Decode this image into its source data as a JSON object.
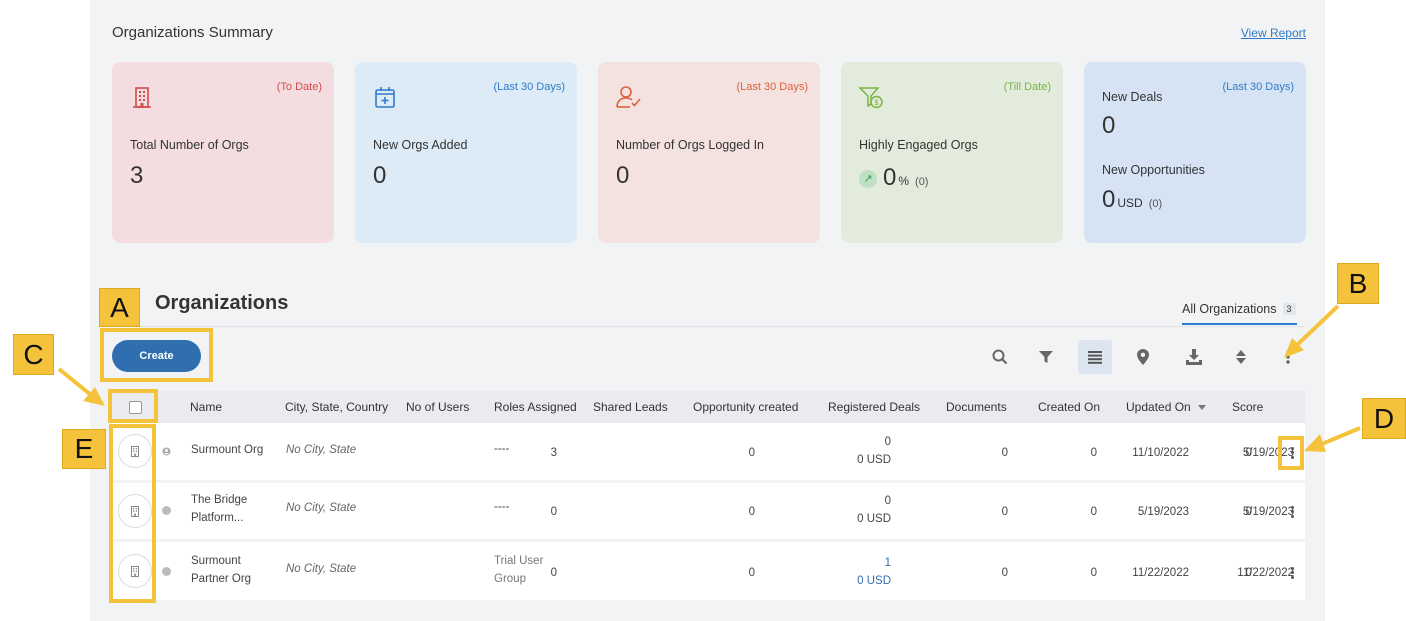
{
  "summary": {
    "title": "Organizations Summary",
    "view_report": "View Report",
    "cards": [
      {
        "period": "(To Date)",
        "label": "Total Number of Orgs",
        "value": "3"
      },
      {
        "period": "(Last 30 Days)",
        "label": "New Orgs Added",
        "value": "0"
      },
      {
        "period": "(Last 30 Days)",
        "label": "Number of Orgs Logged In",
        "value": "0"
      },
      {
        "period": "(Till Date)",
        "label": "Highly Engaged Orgs",
        "value": "0",
        "unit": "%",
        "sub": "(0)"
      },
      {
        "period": "(Last 30 Days)",
        "label": "New Deals",
        "value": "0",
        "label2": "New Opportunities",
        "value2": "0",
        "unit2": "USD",
        "sub2": "(0)"
      }
    ]
  },
  "orgs": {
    "title": "Organizations",
    "tab_label": "All Organizations",
    "tab_count": "3",
    "create_label": "Create"
  },
  "table": {
    "headers": [
      "Name",
      "City, State, Country",
      "No of Users",
      "Roles Assigned",
      "Shared Leads",
      "Opportunity created",
      "Registered Deals",
      "Documents",
      "Created On",
      "Updated On",
      "Score"
    ],
    "rows": [
      {
        "name1": "Surmount Org",
        "name2": "",
        "city": "No City, State",
        "users": "3",
        "roles1": "----",
        "roles2": "",
        "shared": "0",
        "opp_count": "0",
        "opp_usd": "0 USD",
        "deals": "0",
        "docs": "0",
        "created": "11/10/2022",
        "updated": "5/19/2023",
        "score": "0"
      },
      {
        "name1": "The Bridge",
        "name2": "Platform...",
        "city": "No City, State",
        "users": "0",
        "roles1": "----",
        "roles2": "",
        "shared": "0",
        "opp_count": "0",
        "opp_usd": "0 USD",
        "deals": "0",
        "docs": "0",
        "created": "5/19/2023",
        "updated": "5/19/2023",
        "score": "0"
      },
      {
        "name1": "Surmount",
        "name2": "Partner Org",
        "city": "No City, State",
        "users": "0",
        "roles1": "Trial User",
        "roles2": "Group",
        "shared": "0",
        "opp_count": "1",
        "opp_usd": "0 USD",
        "deals": "0",
        "docs": "0",
        "created": "11/22/2022",
        "updated": "11/22/2022",
        "score": "0"
      }
    ]
  },
  "callouts": {
    "a": "A",
    "b": "B",
    "c": "C",
    "d": "D",
    "e": "E"
  },
  "colors": {
    "accent": "#2f6fb0",
    "callout": "#f5c33b"
  }
}
